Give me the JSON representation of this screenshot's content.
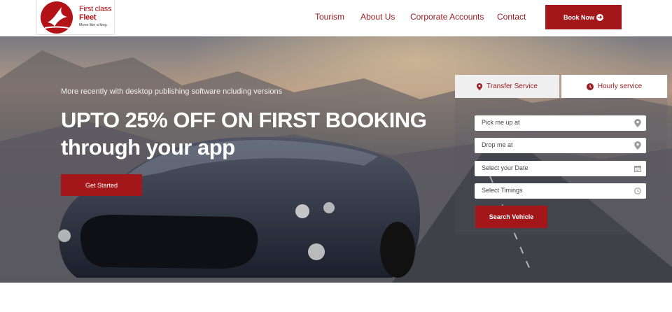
{
  "brand": {
    "name_line1": "First class",
    "name_line2": "Fleet",
    "tagline": "Move like a king."
  },
  "nav": {
    "items": [
      {
        "label": "Tourism"
      },
      {
        "label": "About Us"
      },
      {
        "label": "Corporate Accounts"
      },
      {
        "label": "Contact"
      }
    ],
    "book_button": "Book Now"
  },
  "hero": {
    "subtitle": "More recently with desktop publishing software ncluding versions",
    "title_line1": "UPTO 25% OFF ON FIRST BOOKING",
    "title_line2": "through your app",
    "cta": "Get Started"
  },
  "booking": {
    "tabs": [
      {
        "label": "Transfer Service",
        "icon": "map-marker-icon",
        "active": false
      },
      {
        "label": "Hourly service",
        "icon": "clock-icon",
        "active": true
      }
    ],
    "fields": [
      {
        "placeholder": "Pick me up at",
        "icon": "map-marker-icon"
      },
      {
        "placeholder": "Drop me at",
        "icon": "map-marker-icon"
      },
      {
        "placeholder": "Select your Date",
        "icon": "calendar-icon"
      },
      {
        "placeholder": "Select Timings",
        "icon": "clock-icon"
      }
    ],
    "search_button": "Search Vehicle"
  },
  "colors": {
    "brand_red": "#a3171b",
    "nav_text": "#9a1b1f",
    "white": "#ffffff"
  }
}
